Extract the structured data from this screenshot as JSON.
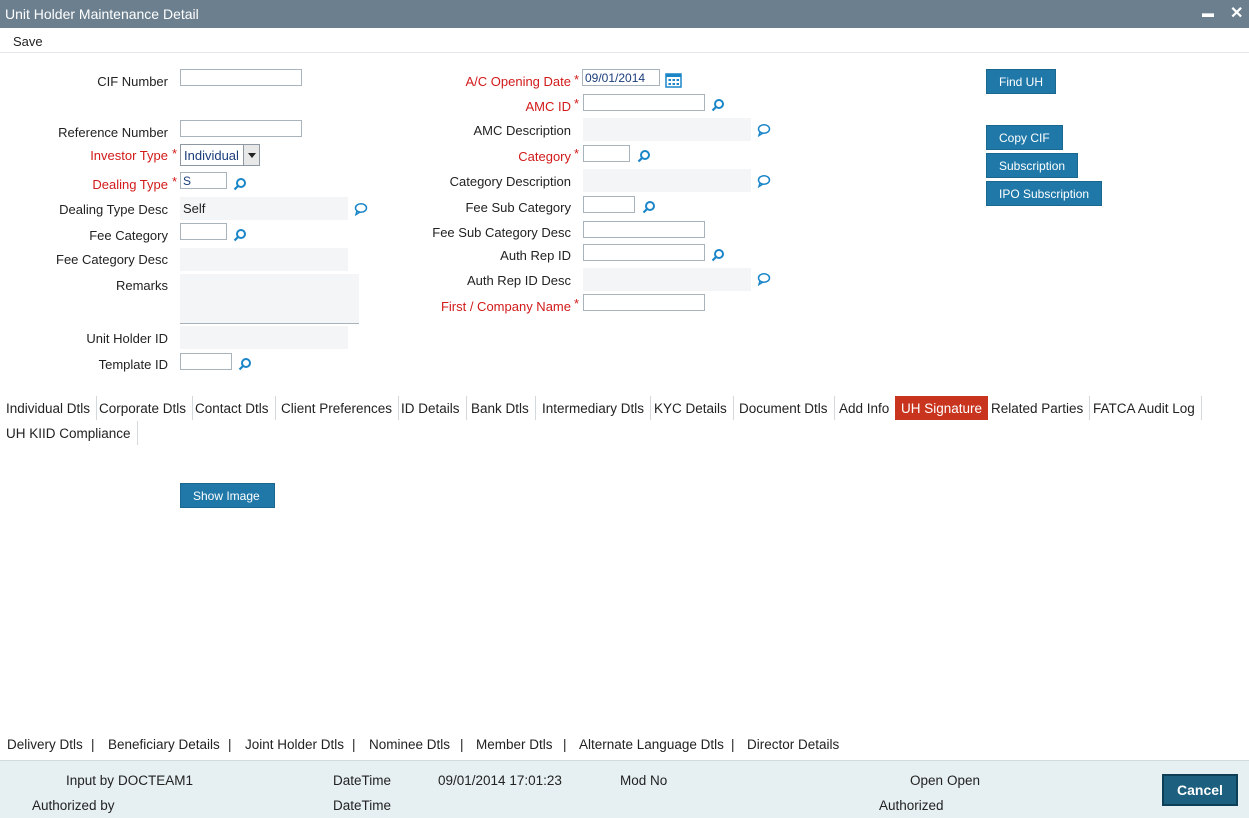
{
  "window": {
    "title": "Unit Holder Maintenance Detail",
    "minimize_label": "▬",
    "close_label": "✕"
  },
  "menu": {
    "save_label": "Save"
  },
  "form": {
    "cif_number": {
      "label": "CIF Number",
      "value": ""
    },
    "reference_number": {
      "label": "Reference Number",
      "value": ""
    },
    "investor_type": {
      "label": "Investor Type",
      "value": "Individual"
    },
    "dealing_type": {
      "label": "Dealing Type",
      "value": "S"
    },
    "dealing_type_desc": {
      "label": "Dealing Type Desc",
      "value": "Self"
    },
    "fee_category": {
      "label": "Fee Category",
      "value": ""
    },
    "fee_category_desc": {
      "label": "Fee Category Desc",
      "value": ""
    },
    "remarks": {
      "label": "Remarks",
      "value": ""
    },
    "unit_holder_id": {
      "label": "Unit Holder ID",
      "value": ""
    },
    "template_id": {
      "label": "Template ID",
      "value": ""
    },
    "ac_opening_date": {
      "label": "A/C Opening Date",
      "value": "09/01/2014"
    },
    "amc_id": {
      "label": "AMC ID",
      "value": ""
    },
    "amc_description": {
      "label": "AMC Description",
      "value": ""
    },
    "category": {
      "label": "Category",
      "value": ""
    },
    "category_description": {
      "label": "Category Description",
      "value": ""
    },
    "fee_sub_category": {
      "label": "Fee Sub Category",
      "value": ""
    },
    "fee_sub_category_desc": {
      "label": "Fee Sub Category Desc",
      "value": ""
    },
    "auth_rep_id": {
      "label": "Auth Rep ID",
      "value": ""
    },
    "auth_rep_id_desc": {
      "label": "Auth Rep ID Desc",
      "value": ""
    },
    "first_company_name": {
      "label": "First / Company Name",
      "value": ""
    },
    "required_marker": "*"
  },
  "buttons": {
    "find_uh": "Find UH",
    "copy_cif": "Copy CIF",
    "subscription": "Subscription",
    "ipo_subscription": "IPO Subscription",
    "show_image": "Show Image",
    "cancel": "Cancel"
  },
  "tabs": [
    {
      "label": "Individual Dtls"
    },
    {
      "label": "Corporate Dtls"
    },
    {
      "label": "Contact Dtls"
    },
    {
      "label": "Client Preferences"
    },
    {
      "label": "ID Details"
    },
    {
      "label": "Bank Dtls"
    },
    {
      "label": "Intermediary Dtls"
    },
    {
      "label": "KYC Details"
    },
    {
      "label": "Document Dtls"
    },
    {
      "label": "Add Info"
    },
    {
      "label": "UH Signature",
      "active": true
    },
    {
      "label": "Related Parties"
    },
    {
      "label": "FATCA Audit Log"
    },
    {
      "label": "UH KIID Compliance"
    }
  ],
  "bottom_links": [
    {
      "label": "Delivery Dtls"
    },
    {
      "label": "Beneficiary Details"
    },
    {
      "label": "Joint Holder Dtls"
    },
    {
      "label": "Nominee Dtls"
    },
    {
      "label": "Member Dtls"
    },
    {
      "label": "Alternate Language Dtls"
    },
    {
      "label": "Director Details"
    }
  ],
  "link_separator": "|",
  "footer": {
    "input_by_label": "Input by",
    "input_by_value": "DOCTEAM1",
    "datetime_label": "DateTime",
    "datetime_value": "09/01/2014 17:01:23",
    "mod_no_label": "Mod No",
    "open_label": "Open",
    "open_value": "Open",
    "authorized_by_label": "Authorized by",
    "datetime2_label": "DateTime",
    "authorized_label": "Authorized"
  },
  "colors": {
    "titlebar": "#6b7f8f",
    "required_label": "#d21a1a",
    "button": "#1f78a8",
    "active_tab": "#c8341e",
    "footer_bg": "#e6eff2",
    "icon": "#1a86c8"
  },
  "icons": {
    "lookup": "magnifier-icon",
    "comment": "speech-bubble-icon",
    "calendar": "calendar-icon"
  }
}
